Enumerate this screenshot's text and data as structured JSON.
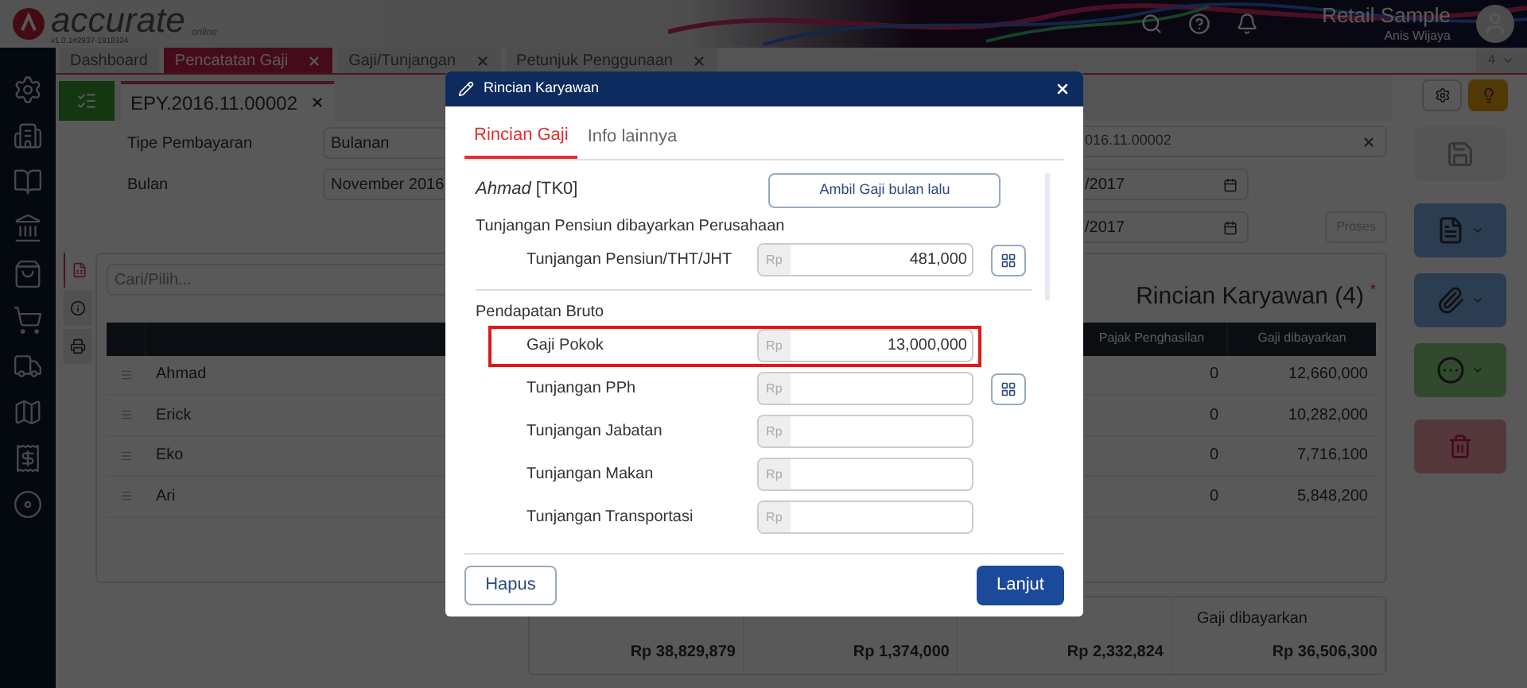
{
  "header": {
    "logo_text": "accurate",
    "logo_sub": "online",
    "version": "v1.0.1#2937-1918324",
    "company": "Retail Sample",
    "user": "Anis Wijaya"
  },
  "tabs": [
    {
      "label": "Dashboard",
      "selected": false,
      "closable": false
    },
    {
      "label": "Pencatatan Gaji",
      "selected": true,
      "closable": true
    },
    {
      "label": "Gaji/Tunjangan",
      "selected": false,
      "closable": true
    },
    {
      "label": "Petunjuk Penggunaan",
      "selected": false,
      "closable": true
    }
  ],
  "tab_count": "4",
  "document_tab": "EPY.2016.11.00002",
  "form": [
    {
      "label": "Tipe Pembayaran",
      "value": "Bulanan"
    },
    {
      "label": "Bulan",
      "value": "November 2016"
    }
  ],
  "right_fields": {
    "number": "016.11.00002",
    "date_1": "/2017",
    "date_2": "/2017",
    "process_button": "Proses"
  },
  "panel": {
    "side_tabs": [
      {
        "selected": true
      },
      {
        "selected": false
      },
      {
        "selected": false
      }
    ],
    "search_placeholder": "Cari/Pilih...",
    "title": "Rincian Karyawan (4)",
    "required_mark": "*",
    "columns": [
      "Pajak Penghasilan",
      "Gaji dibayarkan"
    ],
    "rows": [
      {
        "name": "Ahmad",
        "tax": "0",
        "paid": "12,660,000"
      },
      {
        "name": "Erick",
        "tax": "0",
        "paid": "10,282,000"
      },
      {
        "name": "Eko",
        "tax": "0",
        "paid": "7,716,100"
      },
      {
        "name": "Ari",
        "tax": "0",
        "paid": "5,848,200"
      }
    ]
  },
  "summary": [
    {
      "value": "Rp 38,829,879"
    },
    {
      "value": "Rp 1,374,000"
    },
    {
      "value": "Rp 2,332,824"
    },
    {
      "label": "Gaji dibayarkan",
      "value": "Rp 36,506,300"
    }
  ],
  "dialog": {
    "title": "Rincian Karyawan",
    "tabs": [
      {
        "label": "Rincian Gaji",
        "selected": true
      },
      {
        "label": "Info lainnya",
        "selected": false
      }
    ],
    "employee_name": "Ahmad",
    "employee_code": "[TK0]",
    "fetch_button": "Ambil Gaji bulan lalu",
    "sections": [
      {
        "title": "Tunjangan Pensiun dibayarkan Perusahaan",
        "rows": [
          {
            "label": "Tunjangan Pensiun/THT/JHT",
            "currency": "Rp",
            "value": "481,000",
            "highlighted": false,
            "picker": true
          }
        ]
      },
      {
        "title": "Pendapatan Bruto",
        "rows": [
          {
            "label": "Gaji Pokok",
            "currency": "Rp",
            "value": "13,000,000",
            "highlighted": true,
            "picker": false
          },
          {
            "label": "Tunjangan PPh",
            "currency": "Rp",
            "highlighted": false,
            "picker": true
          },
          {
            "label": "Tunjangan Jabatan",
            "currency": "Rp",
            "highlighted": false,
            "picker": false
          },
          {
            "label": "Tunjangan Makan",
            "currency": "Rp",
            "highlighted": false,
            "picker": false
          },
          {
            "label": "Tunjangan Transportasi",
            "currency": "Rp",
            "highlighted": false,
            "picker": false
          }
        ]
      }
    ],
    "buttons": {
      "delete": "Hapus",
      "next": "Lanjut"
    }
  }
}
